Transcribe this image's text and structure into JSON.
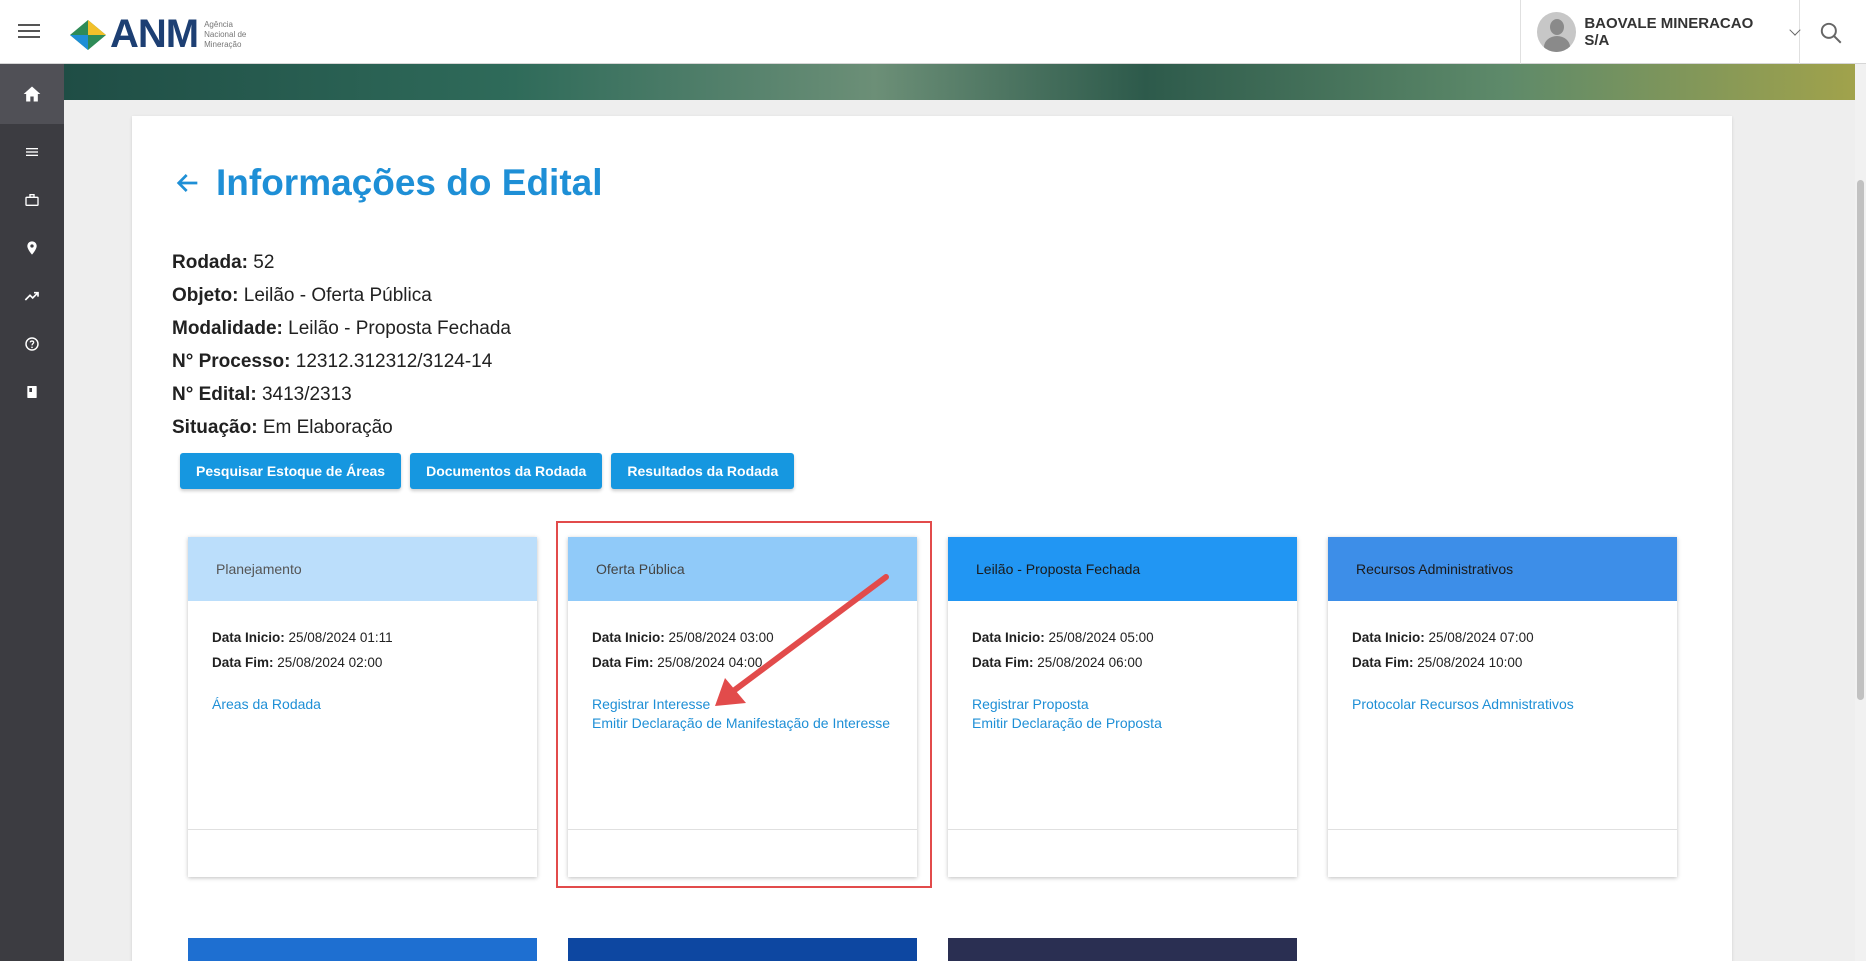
{
  "header": {
    "logo_text": "ANM",
    "logo_subtitle": "Agência Nacional de Mineração",
    "user_name": "BAOVALE MINERACAO S/A"
  },
  "sidebar": {
    "items": [
      "home-icon",
      "menu-icon",
      "briefcase-icon",
      "location-icon",
      "trending-icon",
      "help-icon",
      "book-icon"
    ]
  },
  "page": {
    "title": "Informações do Edital"
  },
  "info": {
    "rodada_label": "Rodada:",
    "rodada_value": "52",
    "objeto_label": "Objeto:",
    "objeto_value": "Leilão - Oferta Pública",
    "modalidade_label": "Modalidade:",
    "modalidade_value": "Leilão - Proposta Fechada",
    "processo_label": "N° Processo:",
    "processo_value": "12312.312312/3124-14",
    "edital_label": "N° Edital:",
    "edital_value": "3413/2313",
    "situacao_label": "Situação:",
    "situacao_value": "Em Elaboração"
  },
  "buttons": {
    "pesquisar": "Pesquisar Estoque de Áreas",
    "documentos": "Documentos da Rodada",
    "resultados": "Resultados da Rodada"
  },
  "phases": [
    {
      "title": "Planejamento",
      "header_color": "#bbdefb",
      "title_color": "#555555",
      "inicio_label": "Data Inicio:",
      "inicio": "25/08/2024 01:11",
      "fim_label": "Data Fim:",
      "fim": "25/08/2024 02:00",
      "links": [
        "Áreas da Rodada"
      ]
    },
    {
      "title": "Oferta Pública",
      "header_color": "#90caf9",
      "title_color": "#444444",
      "inicio_label": "Data Inicio:",
      "inicio": "25/08/2024 03:00",
      "fim_label": "Data Fim:",
      "fim": "25/08/2024 04:00",
      "links": [
        "Registrar Interesse",
        "Emitir Declaração de Manifestação de Interesse"
      ]
    },
    {
      "title": "Leilão - Proposta Fechada",
      "header_color": "#2196f3",
      "title_color": "#1a1a1a",
      "inicio_label": "Data Inicio:",
      "inicio": "25/08/2024 05:00",
      "fim_label": "Data Fim:",
      "fim": "25/08/2024 06:00",
      "links": [
        "Registrar Proposta",
        "Emitir Declaração de Proposta"
      ]
    },
    {
      "title": "Recursos Administrativos",
      "header_color": "#3d8ee8",
      "title_color": "#1a1a1a",
      "inicio_label": "Data Inicio:",
      "inicio": "25/08/2024 07:00",
      "fim_label": "Data Fim:",
      "fim": "25/08/2024 10:00",
      "links": [
        "Protocolar Recursos Admnistrativos"
      ]
    }
  ],
  "bottom_cards": [
    {
      "color": "#1e6fd1"
    },
    {
      "color": "#0d47a1"
    },
    {
      "color": "#2a2f52"
    }
  ],
  "annotation": {
    "color": "#e24b4b"
  }
}
